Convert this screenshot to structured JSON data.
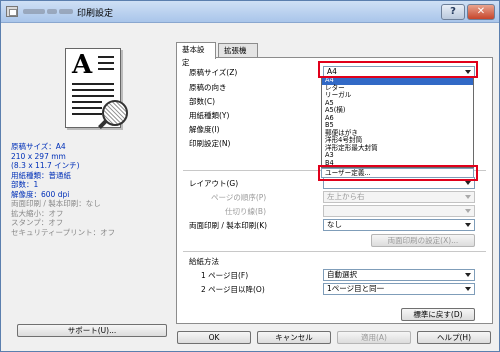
{
  "window": {
    "title": "印刷設定",
    "help_button": "?",
    "close_button": "✕"
  },
  "status": {
    "paper_size_label": "原稿サイズ：A4",
    "paper_size_mm": "210 x 297 mm",
    "paper_size_in": "(8.3 x 11.7 インチ)",
    "media_type": "用紙種類：普通紙",
    "copies": "部数：1",
    "resolution": "解像度：600 dpi",
    "duplex": "両面印刷 / 製本印刷：なし",
    "scaling": "拡大縮小：オフ",
    "stamp": "スタンプ：オフ",
    "security_print": "セキュリティープリント：オフ"
  },
  "support_button": "サポート(U)...",
  "tabs": [
    {
      "label": "基本設定",
      "active": true
    },
    {
      "label": "拡張機能",
      "active": false
    }
  ],
  "basic": {
    "paper_size_label": "原稿サイズ(Z)",
    "paper_size_value": "A4",
    "orientation_label": "原稿の向き",
    "copies_label": "部数(C)",
    "media_type_label": "用紙種類(Y)",
    "resolution_label": "解像度(I)",
    "print_settings_label": "印刷設定(N)",
    "layout_label": "レイアウト(G)",
    "page_order_label": "ページの順序(P)",
    "page_order_value": "左上から右",
    "border_label": "仕切り線(B)",
    "duplex_label": "両面印刷 / 製本印刷(K)",
    "duplex_value": "なし",
    "duplex_settings_button": "両面印刷の設定(X)...",
    "paper_source_heading": "給紙方法",
    "first_page_label": "1 ページ目(F)",
    "first_page_value": "自動選択",
    "other_pages_label": "2 ページ目以降(O)",
    "other_pages_value": "1ページ目と同一",
    "default_button": "標準に戻す(D)"
  },
  "paper_sizes": [
    "A4",
    "レター",
    "リーガル",
    "A5",
    "A5(横)",
    "A6",
    "B5",
    "郵便はがき",
    "洋形4号封筒",
    "洋形定形最大封筒",
    "A3",
    "B4",
    "ユーザー定義..."
  ],
  "paper_size_selected_index": 0,
  "footer": {
    "ok": "OK",
    "cancel": "キャンセル",
    "apply": "適用(A)",
    "help": "ヘルプ(H)"
  },
  "colors": {
    "highlight": "#e0001b",
    "selection": "#3169c6",
    "status_key": "#0030b8"
  }
}
